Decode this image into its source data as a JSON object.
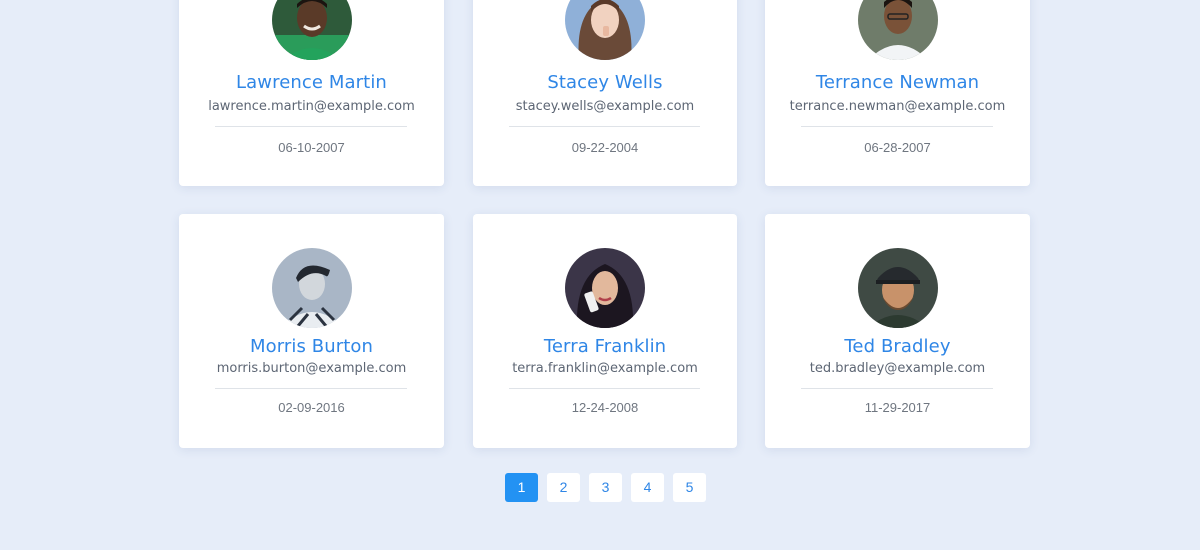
{
  "users": [
    {
      "name": "Lawrence Martin",
      "email": "lawrence.martin@example.com",
      "date": "06-10-2007"
    },
    {
      "name": "Stacey Wells",
      "email": "stacey.wells@example.com",
      "date": "09-22-2004"
    },
    {
      "name": "Terrance Newman",
      "email": "terrance.newman@example.com",
      "date": "06-28-2007"
    },
    {
      "name": "Morris Burton",
      "email": "morris.burton@example.com",
      "date": "02-09-2016"
    },
    {
      "name": "Terra Franklin",
      "email": "terra.franklin@example.com",
      "date": "12-24-2008"
    },
    {
      "name": "Ted Bradley",
      "email": "ted.bradley@example.com",
      "date": "11-29-2017"
    }
  ],
  "pagination": {
    "pages": [
      "1",
      "2",
      "3",
      "4",
      "5"
    ],
    "current": "1"
  },
  "colors": {
    "background": "#e6edf9",
    "accent": "#2392f3",
    "name_text": "#2f86e6"
  }
}
